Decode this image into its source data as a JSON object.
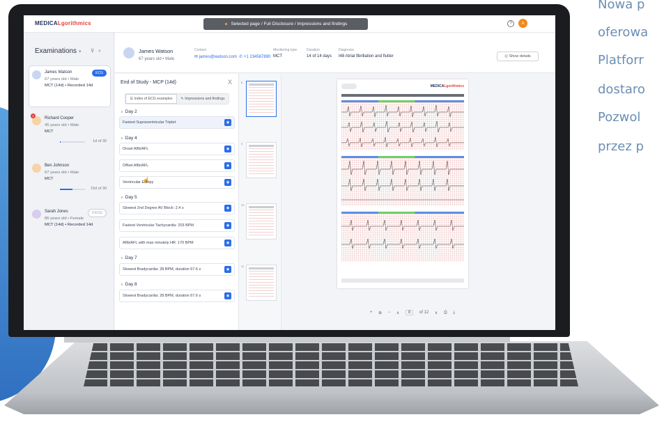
{
  "promo": {
    "lines": [
      "Nowa p",
      "oferowa",
      "Platforr",
      "dostaro",
      "Pozwol",
      "przez p"
    ]
  },
  "app": {
    "logo_prefix": "MEDICA",
    "logo_suffix": "Lgorithmics",
    "breadcrumb": "Selected page / Full Disclosure / Impressions and findings",
    "help": "?",
    "user_initial": "A"
  },
  "sidebar": {
    "title": "Examinations",
    "patients": [
      {
        "name": "James Watson",
        "sub": "67 years old • Male",
        "monitor": "MCT (14d) • Recorded 14d",
        "badge": "ECG",
        "days": ""
      },
      {
        "name": "Richard Cooper",
        "sub": "45 years old • Male",
        "monitor": "MCT",
        "badge": "",
        "days": "1d of 30",
        "alert": "1"
      },
      {
        "name": "Ben Johnson",
        "sub": "67 years old • Male",
        "monitor": "MCT",
        "badge": "",
        "days": "15d of 30"
      },
      {
        "name": "Sarah Jones",
        "sub": "86 years old • Female",
        "monitor": "MCT (14d) • Recorded 14d",
        "badge": "0 ECG",
        "days": ""
      }
    ]
  },
  "patient_header": {
    "name": "James Watson",
    "sub": "67 years old • Male",
    "contact_label": "Contact",
    "email": "james@watson.com",
    "phone": "+1 234567890",
    "monitoring_label": "Monitoring type",
    "monitoring_value": "MCT",
    "duration_label": "Duration",
    "duration_value": "14 of 14 days",
    "diagnosis_label": "Diagnosis",
    "diagnosis_value": "I48 Atrial fibrillation and flutter",
    "show_details": "Show details"
  },
  "panel": {
    "title": "End of Study - MCP (14d)",
    "close": "X",
    "tab_index": "Index of ECG examples",
    "tab_impressions": "Impressions and findings",
    "days": [
      {
        "label": "Day 2",
        "items": [
          "Fastest Supraventricular Triplet"
        ]
      },
      {
        "label": "Day 4",
        "items": [
          "Onset AfIb/AFL",
          "Offset AfIb/AFL",
          "Ventricular Ectopy"
        ]
      },
      {
        "label": "Day 5",
        "items": [
          "Slowest 2nd Degree AV Block: 2.4 s",
          "Fastest Ventricular Tachycardia: 203 BPM",
          "AfIb/AFL with max minutely HR: 170 BPM"
        ]
      },
      {
        "label": "Day 7",
        "items": [
          "Slowest Bradycardia: 28 BPM, duration 67.6 s"
        ]
      },
      {
        "label": "Day 8",
        "items": [
          "Slowest Bradycardia: 28 BPM, duration 67.6 s"
        ]
      }
    ]
  },
  "thumbs": {
    "numbers": [
      "8",
      "9",
      "10",
      "11"
    ]
  },
  "viewer": {
    "page_current": "8",
    "page_total": "of 12"
  },
  "colors": {
    "accent": "#2b6ee6",
    "alert": "#e3423b",
    "user": "#f08a1d"
  }
}
